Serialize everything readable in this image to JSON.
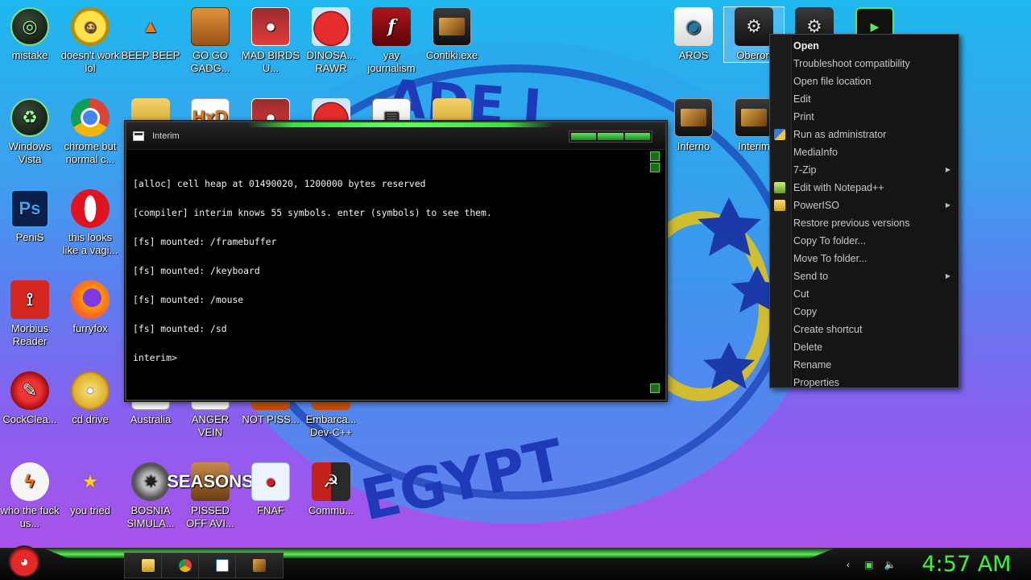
{
  "desktop_icons": [
    {
      "label": "mistake",
      "icon": "xbox-orb-icon"
    },
    {
      "label": "doesn't work lol",
      "icon": "yahoo-messenger-icon"
    },
    {
      "label": "BEEP BEEP",
      "icon": "vlc-cone-icon"
    },
    {
      "label": "GO GO GADG...",
      "icon": "briefcase-icon"
    },
    {
      "label": "MAD BIRDS U...",
      "icon": "angry-birds-space-icon"
    },
    {
      "label": "DINOSA... RAWR",
      "icon": "angry-birds-icon"
    },
    {
      "label": "yay journalism",
      "icon": "flash-icon"
    },
    {
      "label": "Contiki.exe",
      "icon": "terminal-app-icon"
    },
    {
      "label": "AROS",
      "icon": "aros-eye-icon"
    },
    {
      "label": "Oberon",
      "icon": "gear-app-icon"
    },
    {
      "label": "Windows Vista",
      "icon": "recycle-orb-icon"
    },
    {
      "label": "chrome but normal c...",
      "icon": "chrome-icon"
    },
    {
      "label": "Inferno",
      "icon": "terminal-app-icon"
    },
    {
      "label": "Interim",
      "icon": "terminal-app-icon"
    },
    {
      "label": "PeniS",
      "icon": "photoshop-icon"
    },
    {
      "label": "this looks like a vagi...",
      "icon": "opera-icon"
    },
    {
      "label": "Morbius Reader",
      "icon": "pdf-reader-icon"
    },
    {
      "label": "furryfox",
      "icon": "firefox-icon"
    },
    {
      "label": "CockClea...",
      "icon": "ccleaner-icon"
    },
    {
      "label": "cd drive",
      "icon": "cd-drive-icon"
    },
    {
      "label": "Australia",
      "icon": "app-icon"
    },
    {
      "label": "ANGER VEIN",
      "icon": "app-icon"
    },
    {
      "label": "NOT PISS...",
      "icon": "app-icon"
    },
    {
      "label": "Embarca... Dev-C++",
      "icon": "dev-cpp-icon"
    },
    {
      "label": "who the fuck us...",
      "icon": "lightning-icon"
    },
    {
      "label": "you tried",
      "icon": "star-icon"
    },
    {
      "label": "BOSNIA SIMULA...",
      "icon": "spiked-ball-icon"
    },
    {
      "label": "PISSED OFF AVI...",
      "icon": "angry-birds-seasons-icon"
    },
    {
      "label": "FNAF",
      "icon": "angry-birds-icon"
    },
    {
      "label": "Commu...",
      "icon": "communist-flag-icon"
    }
  ],
  "wallpaper": {
    "top_text": "ADE I",
    "bottom_text": "EGYPT"
  },
  "terminal": {
    "title": "Interim",
    "lines": [
      "[alloc] cell heap at 01490020, 1200000 bytes reserved",
      "[compiler] interim knows 55 symbols. enter (symbols) to see them.",
      "[fs] mounted: /framebuffer",
      "[fs] mounted: /keyboard",
      "[fs] mounted: /mouse",
      "[fs] mounted: /sd",
      "interim>"
    ]
  },
  "context_menu": {
    "items": [
      {
        "label": "Open",
        "bold": true,
        "icon": "",
        "submenu": false
      },
      {
        "label": "Troubleshoot compatibility",
        "bold": false,
        "icon": "",
        "submenu": false
      },
      {
        "label": "Open file location",
        "bold": false,
        "icon": "",
        "submenu": false
      },
      {
        "label": "Edit",
        "bold": false,
        "icon": "",
        "submenu": false
      },
      {
        "label": "Print",
        "bold": false,
        "icon": "",
        "submenu": false
      },
      {
        "label": "Run as administrator",
        "bold": false,
        "icon": "uac-shield-icon",
        "submenu": false
      },
      {
        "label": "MediaInfo",
        "bold": false,
        "icon": "",
        "submenu": false
      },
      {
        "label": "7-Zip",
        "bold": false,
        "icon": "",
        "submenu": true
      },
      {
        "label": "Edit with Notepad++",
        "bold": false,
        "icon": "notepad-plus-icon",
        "submenu": false
      },
      {
        "label": "PowerISO",
        "bold": false,
        "icon": "poweriso-icon",
        "submenu": true
      },
      {
        "label": "Restore previous versions",
        "bold": false,
        "icon": "",
        "submenu": false
      },
      {
        "label": "Copy To folder...",
        "bold": false,
        "icon": "",
        "submenu": false
      },
      {
        "label": "Move To folder...",
        "bold": false,
        "icon": "",
        "submenu": false
      },
      {
        "label": "Send to",
        "bold": false,
        "icon": "",
        "submenu": true
      },
      {
        "label": "Cut",
        "bold": false,
        "icon": "",
        "submenu": false
      },
      {
        "label": "Copy",
        "bold": false,
        "icon": "",
        "submenu": false
      },
      {
        "label": "Create shortcut",
        "bold": false,
        "icon": "",
        "submenu": false
      },
      {
        "label": "Delete",
        "bold": false,
        "icon": "",
        "submenu": false
      },
      {
        "label": "Rename",
        "bold": false,
        "icon": "",
        "submenu": false
      },
      {
        "label": "Properties",
        "bold": false,
        "icon": "",
        "submenu": false
      }
    ]
  },
  "taskbar": {
    "start_icon": "angry-bird-orb-icon",
    "pinned": [
      "folder-icon",
      "chrome-icon",
      "aros-eye-icon",
      "terminal-app-icon"
    ],
    "tray": [
      "chevron-left-icon",
      "network-icon",
      "volume-icon"
    ],
    "clock": "4:57 AM"
  },
  "colors": {
    "accent_green": "#3df23d",
    "menu_bg": "#151515",
    "terminal_bg": "#000000"
  }
}
